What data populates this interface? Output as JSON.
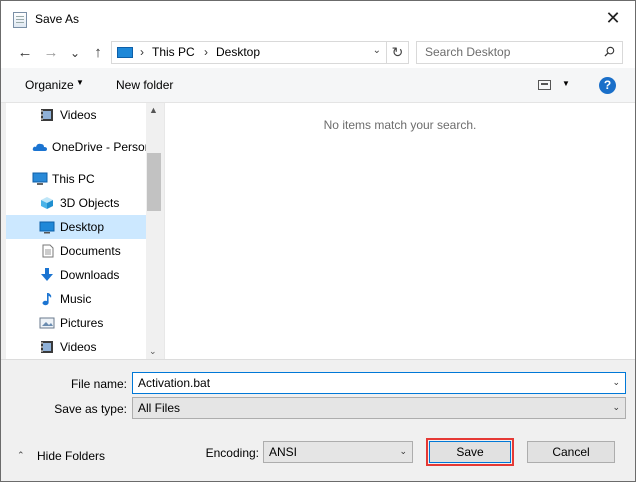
{
  "window": {
    "title": "Save As",
    "close_glyph": "✕"
  },
  "nav": {
    "back_glyph": "←",
    "forward_glyph": "→",
    "recent_glyph": "⌄",
    "up_glyph": "↑"
  },
  "address": {
    "crumbs": [
      "This PC",
      "Desktop"
    ],
    "separator": "›",
    "refresh_glyph": "↻",
    "dropdown_glyph": "⌄"
  },
  "search": {
    "placeholder": "Search Desktop"
  },
  "toolbar": {
    "organize_label": "Organize",
    "dropdown_glyph": "▼",
    "new_folder_label": "New folder",
    "help_glyph": "?"
  },
  "navpane": {
    "items": [
      {
        "label": "Videos",
        "icon": "video-icon"
      },
      {
        "label": "OneDrive - Person",
        "icon": "cloud-icon"
      },
      {
        "label": "This PC",
        "icon": "computer-icon"
      },
      {
        "label": "3D Objects",
        "icon": "cube-icon"
      },
      {
        "label": "Desktop",
        "icon": "desktop-icon",
        "selected": true
      },
      {
        "label": "Documents",
        "icon": "document-icon"
      },
      {
        "label": "Downloads",
        "icon": "download-icon"
      },
      {
        "label": "Music",
        "icon": "music-icon"
      },
      {
        "label": "Pictures",
        "icon": "picture-icon"
      },
      {
        "label": "Videos",
        "icon": "video-icon"
      }
    ],
    "scroll_up_glyph": "▲",
    "scroll_down_glyph": "⌄"
  },
  "content": {
    "empty_message": "No items match your search."
  },
  "form": {
    "filename_label": "File name:",
    "filename_value": "Activation.bat",
    "savetype_label": "Save as type:",
    "savetype_value": "All Files",
    "encoding_label": "Encoding:",
    "encoding_value": "ANSI",
    "combo_arrow": "⌄"
  },
  "footer": {
    "hide_folders_label": "Hide Folders",
    "hide_folders_glyph": "⌃",
    "save_label": "Save",
    "cancel_label": "Cancel"
  },
  "colors": {
    "accent": "#0078d7",
    "highlight_outline": "#e53935",
    "selected_bg": "#cce8ff"
  }
}
